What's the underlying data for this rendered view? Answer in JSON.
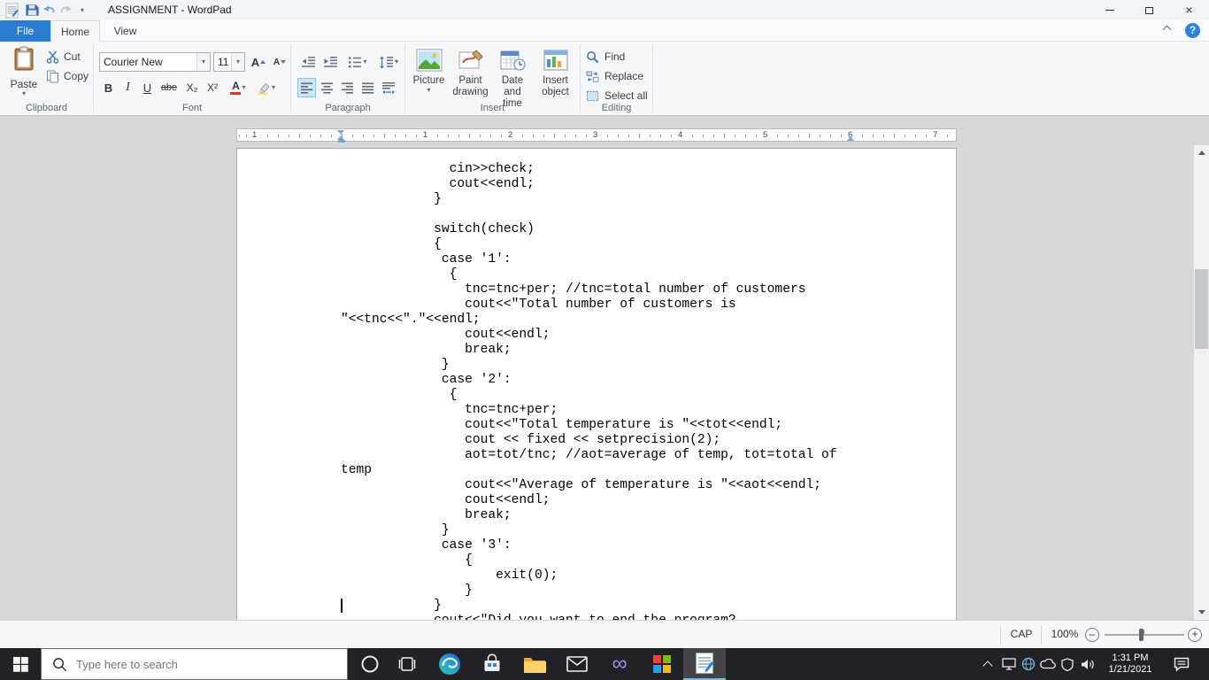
{
  "glyphs": {
    "dropdown": "▾",
    "close": "×",
    "help": "?",
    "minus": "–",
    "plus": "+",
    "bold": "B",
    "italic": "I",
    "underline": "U",
    "strikethrough": "abe",
    "subscript": "X₂",
    "superscript": "X²",
    "font_color_letter": "A",
    "grow_font_letter": "A",
    "shrink_font_letter": "A",
    "infinity": "∞"
  },
  "window": {
    "title": "ASSIGNMENT - WordPad"
  },
  "tabs": [
    {
      "label": "File"
    },
    {
      "label": "Home"
    },
    {
      "label": "View"
    }
  ],
  "ribbon": {
    "clipboard": {
      "label": "Clipboard",
      "paste": "Paste",
      "cut": "Cut",
      "copy": "Copy"
    },
    "font": {
      "label": "Font",
      "family": "Courier New",
      "size": "11"
    },
    "paragraph": {
      "label": "Paragraph"
    },
    "insert": {
      "label": "Insert",
      "items": [
        {
          "line1": "Picture",
          "line2": ""
        },
        {
          "line1": "Paint",
          "line2": "drawing"
        },
        {
          "line1": "Date and",
          "line2": "time"
        },
        {
          "line1": "Insert",
          "line2": "object"
        }
      ]
    },
    "editing": {
      "label": "Editing",
      "find": "Find",
      "replace": "Replace",
      "select_all": "Select all"
    }
  },
  "ruler": {
    "margin_number": "1",
    "numbers": [
      "1",
      "2",
      "3",
      "4",
      "5",
      "6",
      "7"
    ]
  },
  "document": {
    "code_lines": [
      "              cin>>check;",
      "              cout<<endl;",
      "            }",
      "",
      "            switch(check)",
      "            {",
      "             case '1':",
      "              {",
      "                tnc=tnc+per; //tnc=total number of customers",
      "                cout<<\"Total number of customers is",
      "\"<<tnc<<\".\"<<endl;",
      "                cout<<endl;",
      "                break;",
      "             }",
      "             case '2':",
      "              {",
      "                tnc=tnc+per;",
      "                cout<<\"Total temperature is \"<<tot<<endl;",
      "                cout << fixed << setprecision(2);",
      "                aot=tot/tnc; //aot=average of temp, tot=total of",
      "temp",
      "                cout<<\"Average of temperature is \"<<aot<<endl;",
      "                cout<<endl;",
      "                break;",
      "             }",
      "             case '3':",
      "                {",
      "                    exit(0);",
      "                }",
      "            }",
      "            cout<<\"Did you want to end the program?"
    ]
  },
  "status_bar": {
    "caps": "CAP",
    "zoom": "100%"
  },
  "taskbar": {
    "search_placeholder": "Type here to search",
    "apps": [
      "edge",
      "microsoft-store",
      "file-explorer",
      "mail",
      "visual-studio",
      "office",
      "wordpad"
    ],
    "clock": {
      "time": "1:31 PM",
      "date": "1/21/2021"
    }
  }
}
